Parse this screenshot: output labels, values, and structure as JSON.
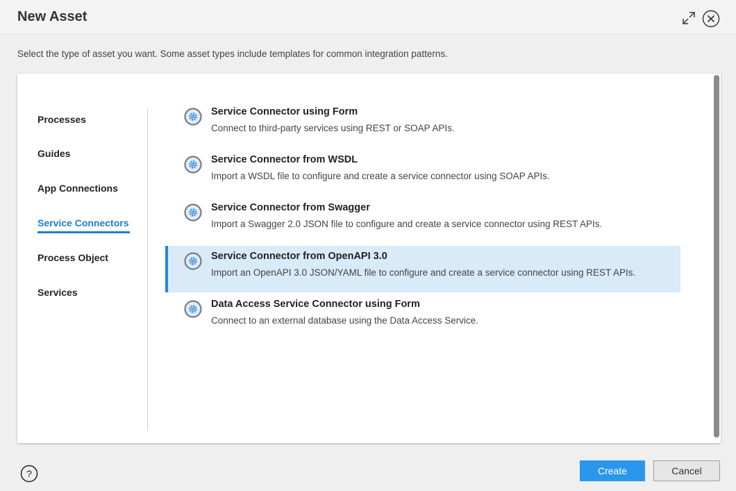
{
  "dialog": {
    "title": "New Asset",
    "subtitle": "Select the type of asset you want. Some asset types include templates for common integration patterns."
  },
  "header_icons": {
    "expand": "expand-icon",
    "close": "close-circle-icon"
  },
  "nav": {
    "items": [
      {
        "label": "Processes",
        "active": false
      },
      {
        "label": "Guides",
        "active": false
      },
      {
        "label": "App Connections",
        "active": false
      },
      {
        "label": "Service Connectors",
        "active": true
      },
      {
        "label": "Process Object",
        "active": false
      },
      {
        "label": "Services",
        "active": false
      }
    ]
  },
  "options": [
    {
      "title": "Service Connector using Form",
      "desc": "Connect to third-party services using REST or SOAP APIs.",
      "icon": "gear-icon",
      "selected": false
    },
    {
      "title": "Service Connector from WSDL",
      "desc": "Import a WSDL file to configure and create a service connector using SOAP APIs.",
      "icon": "gear-icon",
      "selected": false
    },
    {
      "title": "Service Connector from Swagger",
      "desc": "Import a Swagger 2.0 JSON file to configure and create a service connector using REST APIs.",
      "icon": "gear-icon",
      "selected": false
    },
    {
      "title": "Service Connector from OpenAPI 3.0",
      "desc": "Import an OpenAPI 3.0 JSON/YAML file to configure and create a service connector using REST APIs.",
      "icon": "gear-icon",
      "selected": true
    },
    {
      "title": "Data Access Service Connector using Form",
      "desc": "Connect to an external database using the Data Access Service.",
      "icon": "gear-icon",
      "selected": false
    }
  ],
  "footer": {
    "help_icon": "help-icon",
    "create_label": "Create",
    "cancel_label": "Cancel"
  },
  "colors": {
    "accent": "#1e7bd3",
    "selected_bg": "#d9eaf9",
    "primary_button": "#2b97ec"
  }
}
